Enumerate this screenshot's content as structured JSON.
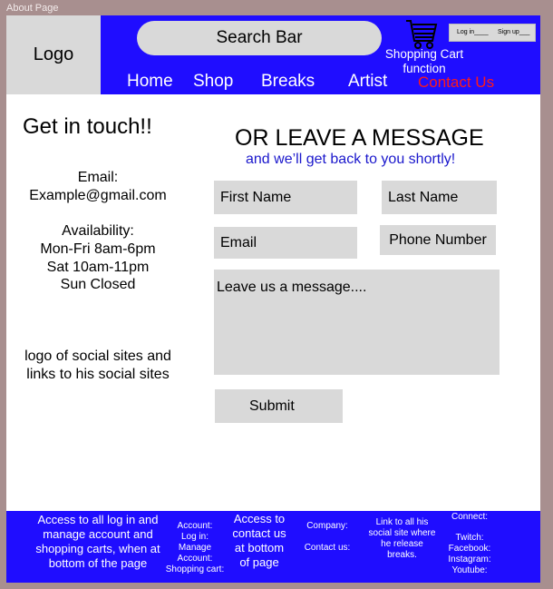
{
  "frame_label": "About Page",
  "header": {
    "logo": "Logo",
    "search": "Search Bar",
    "cart_label": "Shopping Cart function",
    "auth": {
      "login": "Log in____",
      "signup": "Sign up___"
    },
    "nav": [
      "Home",
      "Shop",
      "Breaks",
      "Artist",
      "Contact Us"
    ]
  },
  "left": {
    "title": "Get in touch!!",
    "email_label": "Email:",
    "email_value": "Example@gmail.com",
    "availability_label": "Availability:",
    "hours": [
      "Mon-Fri 8am-6pm",
      "Sat 10am-11pm",
      "Sun Closed"
    ],
    "social": "logo of social sites and links to his social sites"
  },
  "form": {
    "heading": "OR LEAVE A MESSAGE",
    "subheading": "and we’ll get back to you shortly!",
    "first_name": "First Name",
    "last_name": "Last Name",
    "email": "Email",
    "phone": "Phone Number",
    "message": "Leave us a message....",
    "submit": "Submit"
  },
  "footer": {
    "col1": "Access to all log in and manage account and shopping carts, when at bottom of the page",
    "col2": [
      "Account:",
      "Log in:",
      "Manage Account:",
      "Shopping cart:"
    ],
    "col3": "Access to contact us at bottom of page",
    "col4_company": "Company:",
    "col4_contact": "Contact us:",
    "col5": "Link to all his social site where he release breaks.",
    "col6_title": "Connect:",
    "col6_items": [
      "Twitch:",
      "Facebook:",
      "Instagram:",
      "Youtube:"
    ]
  },
  "colors": {
    "blue": "#1f0dff",
    "gray": "#d9d9d9",
    "active_nav": "#ff1a1a",
    "frame": "#a88f8f"
  }
}
